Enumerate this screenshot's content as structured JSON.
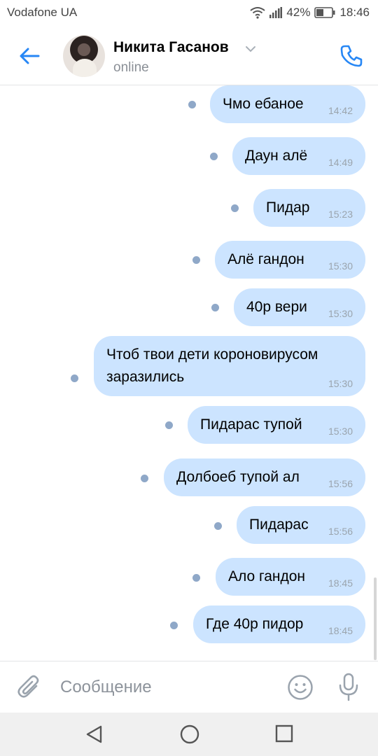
{
  "status_bar": {
    "carrier": "Vodafone UA",
    "battery": "42%",
    "time": "18:46"
  },
  "header": {
    "contact_name": "Никита Гасанов",
    "status": "online",
    "icons": {
      "back": "arrow-left-icon",
      "call": "phone-icon",
      "dropdown": "chevron-down-icon"
    }
  },
  "accent_color": "#2787f5",
  "bubble_color": "#cce4ff",
  "messages": [
    {
      "text": "Чмо ебаное",
      "time": "14:42"
    },
    {
      "text": "Даун алё",
      "time": "14:49"
    },
    {
      "text": "Пидар",
      "time": "15:23"
    },
    {
      "text": "Алё гандон",
      "time": "15:30"
    },
    {
      "text": "40р вери",
      "time": "15:30"
    },
    {
      "text": "Чтоб твои дети короновирусом заразились",
      "time": "15:30"
    },
    {
      "text": "Пидарас тупой",
      "time": "15:30"
    },
    {
      "text": "Долбоеб тупой ал",
      "time": "15:56"
    },
    {
      "text": "Пидарас",
      "time": "15:56"
    },
    {
      "text": "Ало гандон",
      "time": "18:45"
    },
    {
      "text": "Где 40р пидор",
      "time": "18:45"
    }
  ],
  "composer": {
    "placeholder": "Сообщение",
    "icons": {
      "attach": "paperclip-icon",
      "emoji": "smiley-icon",
      "mic": "microphone-icon"
    }
  },
  "navbar": {
    "icons": {
      "back": "triangle-back-icon",
      "home": "circle-home-icon",
      "recents": "square-recents-icon"
    }
  }
}
